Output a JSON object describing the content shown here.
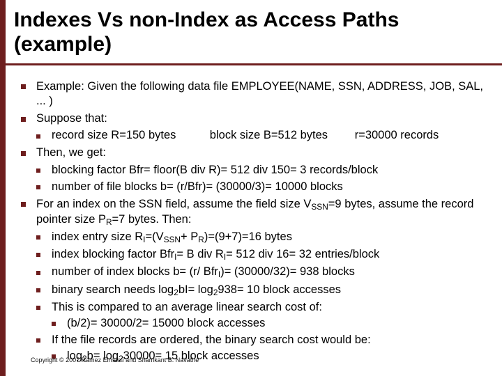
{
  "title": "Indexes Vs non-Index as Access Paths (example)",
  "b1": "Example: Given the following data file EMPLOYEE(NAME, SSN, ADDRESS, JOB, SAL, ... )",
  "b2": "Suppose that:",
  "b2a_c1": "record size R=150 bytes",
  "b2a_c2": "block size B=512 bytes",
  "b2a_c3": "r=30000 records",
  "b3": "Then, we get:",
  "b3a": "blocking factor Bfr= floor(B div R)= 512 div 150= 3 records/block",
  "b3b": "number of file blocks b= (r/Bfr)= (30000/3)= 10000 blocks",
  "b4_pre": "For an index on the SSN field, assume the field size V",
  "b4_sub1": "SSN",
  "b4_mid": "=9 bytes, assume the record pointer size P",
  "b4_sub2": "R",
  "b4_post": "=7 bytes. Then:",
  "b4a_pre": "index entry size R",
  "b4a_sub1": "I",
  "b4a_mid1": "=(V",
  "b4a_sub2": "SSN",
  "b4a_mid2": "+ P",
  "b4a_sub3": "R",
  "b4a_post": ")=(9+7)=16 bytes",
  "b4b_pre": "index blocking factor Bfr",
  "b4b_sub1": "I",
  "b4b_mid": "= B div R",
  "b4b_sub2": "I",
  "b4b_post": "= 512 div 16= 32 entries/block",
  "b4c_pre": "number of index blocks b= (r/ Bfr",
  "b4c_sub": "I",
  "b4c_post": ")= (30000/32)= 938 blocks",
  "b4d_pre": "binary search needs log",
  "b4d_sub1": "2",
  "b4d_mid": "bI= log",
  "b4d_sub2": "2",
  "b4d_post": "938= 10 block accesses",
  "b4e": "This is compared to an average linear search cost of:",
  "b4e1": "(b/2)= 30000/2= 15000 block accesses",
  "b4f": "If the file records are ordered, the binary search cost would be:",
  "b4f1_pre": "log",
  "b4f1_sub1": "2",
  "b4f1_mid": "b=  log",
  "b4f1_sub2": "2",
  "b4f1_post": "30000= 15 block accesses",
  "copyright": "Copyright © 2007 Ramez Elmasri and Shamkant B. Navathe"
}
